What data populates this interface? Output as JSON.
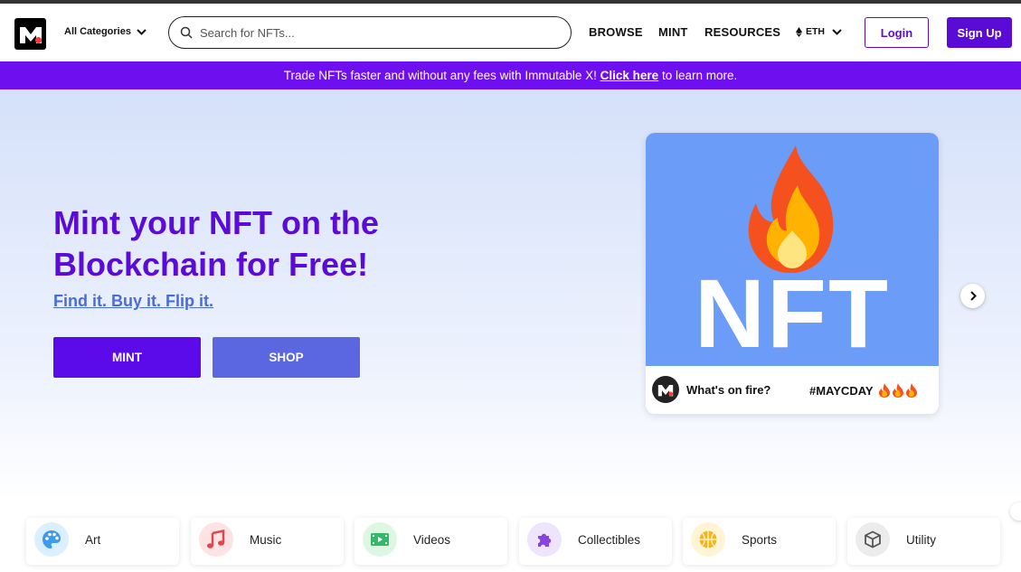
{
  "header": {
    "categories_label": "All Categories",
    "search_placeholder": "Search for NFTs...",
    "nav": [
      "BROWSE",
      "MINT",
      "RESOURCES"
    ],
    "currency": "ETH",
    "login_label": "Login",
    "signup_label": "Sign Up"
  },
  "banner": {
    "text_before": "Trade NFTs faster and without any fees with Immutable X!",
    "link_text": "Click here",
    "text_after": "to learn more."
  },
  "hero": {
    "title": "Mint your NFT on the Blockchain for Free!",
    "subtitle": "Find it. Buy it. Flip it.",
    "mint_label": "MINT",
    "shop_label": "SHOP"
  },
  "featured_card": {
    "image_text": "NFT",
    "caption": "What's on fire?",
    "tag": "#MAYCDAY"
  },
  "categories": [
    {
      "label": "Art",
      "icon": "palette-icon",
      "bg": "#dcefff",
      "fg": "#3d9be9"
    },
    {
      "label": "Music",
      "icon": "music-note-icon",
      "bg": "#fde3e3",
      "fg": "#e0474c"
    },
    {
      "label": "Videos",
      "icon": "film-icon",
      "bg": "#def7e3",
      "fg": "#36b86a"
    },
    {
      "label": "Collectibles",
      "icon": "puzzle-icon",
      "bg": "#eee4fb",
      "fg": "#8a43e0"
    },
    {
      "label": "Sports",
      "icon": "basketball-icon",
      "bg": "#fff4d6",
      "fg": "#f2b81b"
    },
    {
      "label": "Utility",
      "icon": "cube-icon",
      "bg": "#ececec",
      "fg": "#555555"
    }
  ],
  "colors": {
    "brand_purple": "#5b0bd6",
    "banner_purple": "#6e0ff0",
    "shop_blue": "#5a67e0",
    "card_blue": "#6b9cf7"
  }
}
